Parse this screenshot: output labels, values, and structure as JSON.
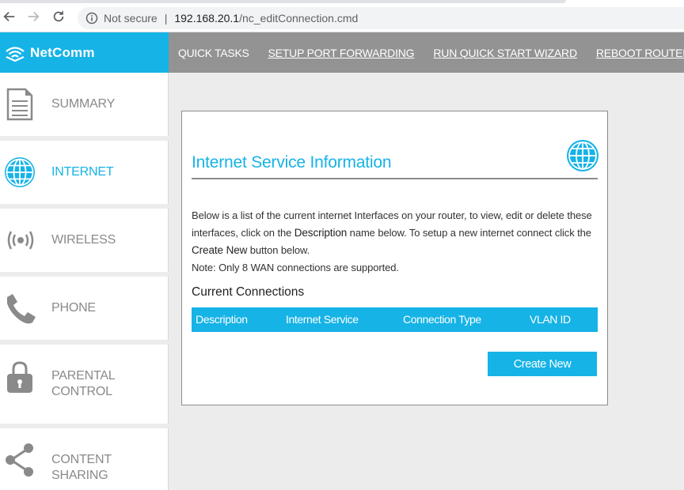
{
  "browser": {
    "security_label": "Not secure",
    "separator": "|",
    "url_host": "192.168.20.1",
    "url_path": "/nc_editConnection.cmd"
  },
  "header": {
    "logo_text": "NetComm",
    "quick_tasks_label": "QUICK TASKS",
    "links": [
      {
        "label": "SETUP PORT FORWARDING"
      },
      {
        "label": "RUN QUICK START WIZARD"
      },
      {
        "label": "REBOOT ROUTER"
      }
    ]
  },
  "sidebar": {
    "items": [
      {
        "line1": "SUMMARY",
        "line2": "",
        "icon": "document-icon"
      },
      {
        "line1": "INTERNET",
        "line2": "",
        "icon": "globe-icon",
        "active": true
      },
      {
        "line1": "WIRELESS",
        "line2": "",
        "icon": "wireless-icon"
      },
      {
        "line1": "PHONE",
        "line2": "",
        "icon": "phone-icon"
      },
      {
        "line1": "PARENTAL",
        "line2": "CONTROL",
        "icon": "lock-icon"
      },
      {
        "line1": "CONTENT",
        "line2": "SHARING",
        "icon": "share-icon"
      }
    ]
  },
  "main": {
    "title": "Internet Service Information",
    "description": {
      "part1": "Below is a list of the current internet Interfaces on your router, to view, edit or delete these interfaces, click on the ",
      "bold1": "Description",
      "part2": " name below. To setup a new internet connect click the ",
      "bold2": "Create New",
      "part3": " button below.",
      "note": "Note: Only 8 WAN connections are supported."
    },
    "section_title": "Current Connections",
    "table_headers": [
      "Description",
      "Internet Service",
      "Connection Type",
      "VLAN ID"
    ],
    "create_button_label": "Create New"
  },
  "colors": {
    "accent": "#16b3e6",
    "header_gray": "#939393",
    "background": "#ececec"
  }
}
